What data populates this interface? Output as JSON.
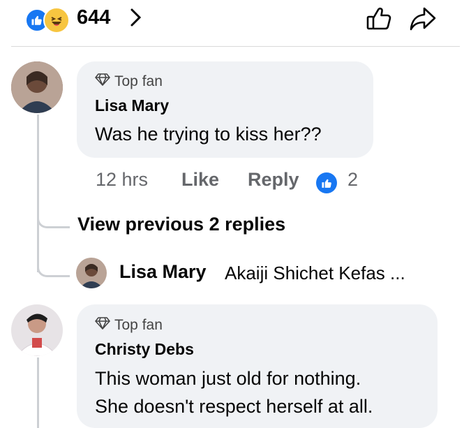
{
  "reactions": {
    "count": "644",
    "like_color": "#1877f2",
    "haha_color": "#f7c540",
    "icons": [
      "like-reaction-icon",
      "haha-reaction-icon",
      "chevron-right-icon",
      "like-outline-icon",
      "share-icon"
    ]
  },
  "comment1": {
    "badge": "Top fan",
    "author": "Lisa Mary",
    "text": "Was he trying to kiss her??",
    "time": "12 hrs",
    "like_label": "Like",
    "reply_label": "Reply",
    "like_count": "2"
  },
  "replies": {
    "view_previous": "View previous 2 replies",
    "latest_author": "Lisa Mary",
    "latest_preview": "Akaiji Shichet Kefas ..."
  },
  "comment2": {
    "badge": "Top fan",
    "author": "Christy Debs",
    "text_line1": "This woman just old for nothing.",
    "text_line2": "She doesn't respect herself at all."
  }
}
